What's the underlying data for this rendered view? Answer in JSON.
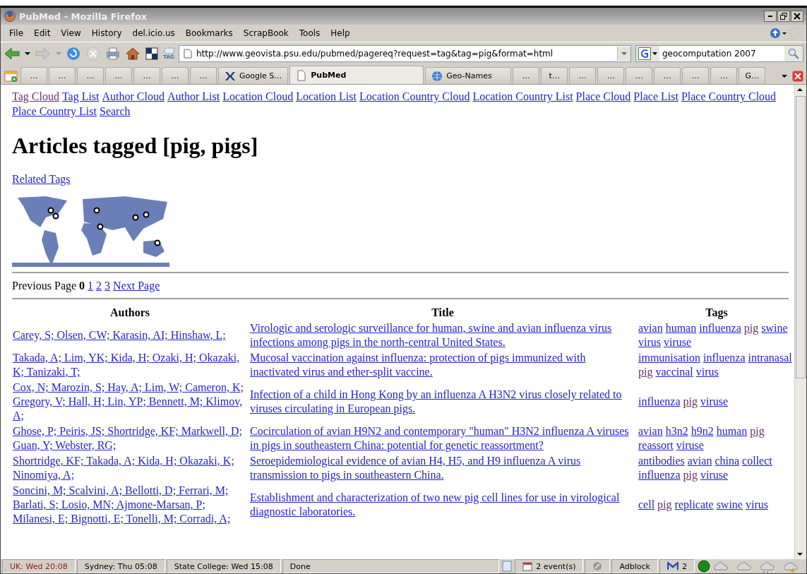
{
  "window": {
    "title": "PubMed - Mozilla Firefox"
  },
  "menu": [
    "File",
    "Edit",
    "View",
    "History",
    "del.icio.us",
    "Bookmarks",
    "ScrapBook",
    "Tools",
    "Help"
  ],
  "toolbar": {
    "tag_label": "TAG",
    "address": "http://www.geovista.psu.edu/pubmed/pagereq?request=tag&tag=pig&format=html",
    "search": "geocomputation 2007"
  },
  "tabs": [
    {
      "label": "…",
      "kind": "plain",
      "selected": false
    },
    {
      "label": "…",
      "kind": "plain",
      "selected": false
    },
    {
      "label": "…",
      "kind": "plain",
      "selected": false
    },
    {
      "label": "…",
      "kind": "plain",
      "selected": false
    },
    {
      "label": "…",
      "kind": "plain",
      "selected": false
    },
    {
      "label": "…",
      "kind": "plain",
      "selected": false
    },
    {
      "label": "…",
      "kind": "plain",
      "selected": false
    },
    {
      "label": "Google S…",
      "kind": "x-logo",
      "selected": false
    },
    {
      "label": "PubMed",
      "kind": "page",
      "selected": true
    },
    {
      "label": "Geo-Names",
      "kind": "globe",
      "selected": false
    },
    {
      "label": "…",
      "kind": "plain",
      "selected": false
    },
    {
      "label": "t…",
      "kind": "plain",
      "selected": false
    },
    {
      "label": "…",
      "kind": "plain",
      "selected": false
    },
    {
      "label": "…",
      "kind": "plain",
      "selected": false
    },
    {
      "label": "…",
      "kind": "plain",
      "selected": false
    },
    {
      "label": "…",
      "kind": "plain",
      "selected": false
    },
    {
      "label": "…",
      "kind": "plain",
      "selected": false
    },
    {
      "label": "…",
      "kind": "plain",
      "selected": false
    },
    {
      "label": "G…",
      "kind": "plain",
      "selected": false
    }
  ],
  "page": {
    "nav_links": [
      {
        "label": "Tag Cloud",
        "visited": true
      },
      {
        "label": "Tag List",
        "visited": false
      },
      {
        "label": "Author Cloud",
        "visited": false
      },
      {
        "label": "Author List",
        "visited": false
      },
      {
        "label": "Location Cloud",
        "visited": false
      },
      {
        "label": "Location List",
        "visited": false
      },
      {
        "label": "Location Country Cloud",
        "visited": false
      },
      {
        "label": "Location Country List",
        "visited": false
      },
      {
        "label": "Place Cloud",
        "visited": false
      },
      {
        "label": "Place List",
        "visited": false
      },
      {
        "label": "Place Country Cloud",
        "visited": false
      },
      {
        "label": "Place Country List",
        "visited": false
      },
      {
        "label": "Search",
        "visited": false
      }
    ],
    "heading": "Articles tagged [pig, pigs]",
    "related_tags": "Related Tags",
    "pager": {
      "previous": "Previous Page",
      "current": "0",
      "pages": [
        "1",
        "2",
        "3"
      ],
      "next": "Next Page"
    },
    "table": {
      "columns": [
        "Authors",
        "Title",
        "Tags"
      ],
      "rows": [
        {
          "authors": "Carey, S; Olsen, CW; Karasin, AI; Hinshaw, L;",
          "title": "Virologic and serologic surveillance for human, swine and avian influenza virus infections among pigs in the north-central United States.",
          "tags": [
            {
              "label": "avian",
              "visited": false
            },
            {
              "label": "human",
              "visited": false
            },
            {
              "label": "influenza",
              "visited": false
            },
            {
              "label": "pig",
              "visited": true
            },
            {
              "label": "swine",
              "visited": false
            },
            {
              "label": "virus",
              "visited": false
            },
            {
              "label": "viruse",
              "visited": false
            }
          ]
        },
        {
          "authors": "Takada, A; Lim, YK; Kida, H; Ozaki, H; Okazaki, K; Tanizaki, T;",
          "title": "Mucosal vaccination against influenza: protection of pigs immunized with inactivated virus and ether-split vaccine.",
          "tags": [
            {
              "label": "immunisation",
              "visited": false
            },
            {
              "label": "influenza",
              "visited": false
            },
            {
              "label": "intranasal",
              "visited": false
            },
            {
              "label": "pig",
              "visited": true
            },
            {
              "label": "vaccinal",
              "visited": false
            },
            {
              "label": "virus",
              "visited": false
            }
          ]
        },
        {
          "authors": "Cox, N; Marozin, S; Hay, A; Lim, W; Cameron, K; Gregory, V; Hall, H; Lin, YP; Bennett, M; Klimov, A;",
          "title": "Infection of a child in Hong Kong by an influenza A H3N2 virus closely related to viruses circulating in European pigs.",
          "tags": [
            {
              "label": "influenza",
              "visited": false
            },
            {
              "label": "pig",
              "visited": true
            },
            {
              "label": "viruse",
              "visited": false
            }
          ]
        },
        {
          "authors": "Ghose, P; Peiris, JS; Shortridge, KF; Markwell, D; Guan, Y; Webster, RG;",
          "title": "Cocirculation of avian H9N2 and contemporary \"human\" H3N2 influenza A viruses in pigs in southeastern China: potential for genetic reassortment?",
          "tags": [
            {
              "label": "avian",
              "visited": false
            },
            {
              "label": "h3n2",
              "visited": false
            },
            {
              "label": "h9n2",
              "visited": false
            },
            {
              "label": "human",
              "visited": false
            },
            {
              "label": "pig",
              "visited": true
            },
            {
              "label": "reassort",
              "visited": false
            },
            {
              "label": "viruse",
              "visited": false
            }
          ]
        },
        {
          "authors": "Shortridge, KF; Takada, A; Kida, H; Okazaki, K; Ninomiya, A;",
          "title": "Seroepidemiological evidence of avian H4, H5, and H9 influenza A virus transmission to pigs in southeastern China.",
          "tags": [
            {
              "label": "antibodies",
              "visited": false
            },
            {
              "label": "avian",
              "visited": false
            },
            {
              "label": "china",
              "visited": false
            },
            {
              "label": "collect",
              "visited": false
            },
            {
              "label": "influenza",
              "visited": false
            },
            {
              "label": "pig",
              "visited": true
            },
            {
              "label": "viruse",
              "visited": false
            }
          ]
        },
        {
          "authors": "Soncini, M; Scalvini, A; Bellotti, D; Ferrari, M; Barlati, S; Losio, MN; Ajmone-Marsan, P; Milanesi, E; Bignotti, E; Tonelli, M; Corradi, A;",
          "title": "Establishment and characterization of two new pig cell lines for use in virological diagnostic laboratories.",
          "tags": [
            {
              "label": "cell",
              "visited": false
            },
            {
              "label": "pig",
              "visited": true
            },
            {
              "label": "replicate",
              "visited": false
            },
            {
              "label": "swine",
              "visited": false
            },
            {
              "label": "virus",
              "visited": false
            }
          ]
        }
      ]
    }
  },
  "status_bar": {
    "clocks": [
      {
        "label": "UK: Wed 20:08",
        "color": "#8b1a1a"
      },
      {
        "label": "Sydney: Thu 05:08",
        "color": "#000000"
      },
      {
        "label": "State College: Wed 15:08",
        "color": "#000000"
      }
    ],
    "status": "Done",
    "events": "2 event(s)",
    "adblock": "Adblock",
    "mail_count": "2"
  }
}
